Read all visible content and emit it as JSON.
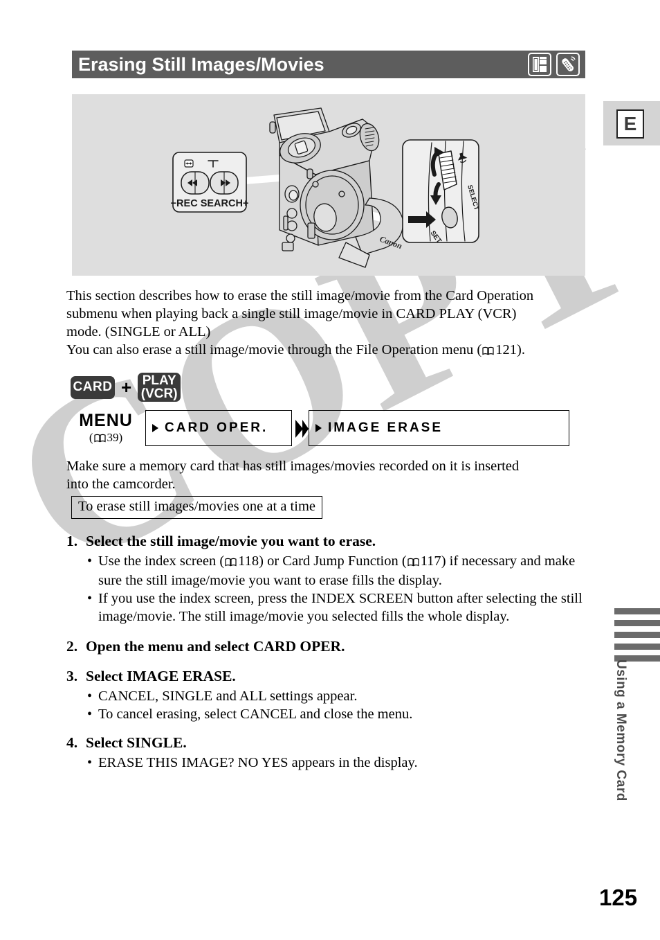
{
  "header": {
    "title": "Erasing Still Images/Movies",
    "icons": [
      {
        "name": "card-camcorder-icon",
        "label": "CARD"
      },
      {
        "name": "remote-control-icon",
        "label": "REMOTE"
      }
    ]
  },
  "margin_tab": {
    "letter": "E"
  },
  "illustration": {
    "caption_left": "−REC SEARCH+",
    "callout_left_labels": [
      "REC SEARCH"
    ],
    "callout_right_labels": [
      "SELECT",
      "SET"
    ],
    "brand": "Canon"
  },
  "intro": {
    "line1": "This section describes how to erase the still image/movie from the Card Operation",
    "line2": "submenu when playing back a single still image/movie in CARD PLAY (VCR)",
    "line3": "mode. (SINGLE or ALL)",
    "line4_pre": "You can also erase a still image/movie through the File Operation menu (",
    "line4_ref": "121",
    "line4_post": ")."
  },
  "mode": {
    "card_label": "CARD",
    "plus": "+",
    "play_line1": "PLAY",
    "play_line2": "(VCR)"
  },
  "menu": {
    "label": "MENU",
    "ref_open": "(",
    "ref_page": "39",
    "ref_close": ")",
    "box1": "CARD OPER.",
    "box2": "IMAGE ERASE"
  },
  "note": {
    "line1": "Make sure a memory card that has still images/movies recorded on it is inserted",
    "line2": "into the camcorder."
  },
  "boxed_subtitle": "To erase still images/movies one at a time",
  "steps": [
    {
      "num": "1.",
      "title": "Select the still image/movie you want to erase.",
      "bullets": [
        "Use the index screen ( 118) or Card Jump Function ( 117) if necessary and make sure the still image/movie you want to erase fills the display.",
        "If you use the index screen, press the INDEX SCREEN button after selecting the still image/movie. The still image/movie you selected fills the whole display."
      ],
      "bullet_refs": [
        "118",
        "117"
      ]
    },
    {
      "num": "2.",
      "title": "Open the menu and select CARD OPER.",
      "bullets": []
    },
    {
      "num": "3.",
      "title": "Select IMAGE ERASE.",
      "bullets": [
        "CANCEL, SINGLE and ALL settings appear.",
        "To cancel erasing, select CANCEL and close the menu."
      ]
    },
    {
      "num": "4.",
      "title": "Select SINGLE.",
      "bullets": [
        "ERASE THIS IMAGE? NO YES appears in the display."
      ]
    }
  ],
  "sidebar": {
    "label": "Using a Memory Card",
    "bar_count": 5
  },
  "page_number": "125",
  "watermark": {
    "text": "COPY"
  },
  "colors": {
    "header_bar": "#5d5d5d",
    "illustration_bg": "#dedede",
    "badge_bg": "#3a3a3a",
    "sidebar_bar": "#6b6b6b",
    "margin_tab_bg": "#d4d4d4",
    "watermark": "#cfcfcf"
  }
}
